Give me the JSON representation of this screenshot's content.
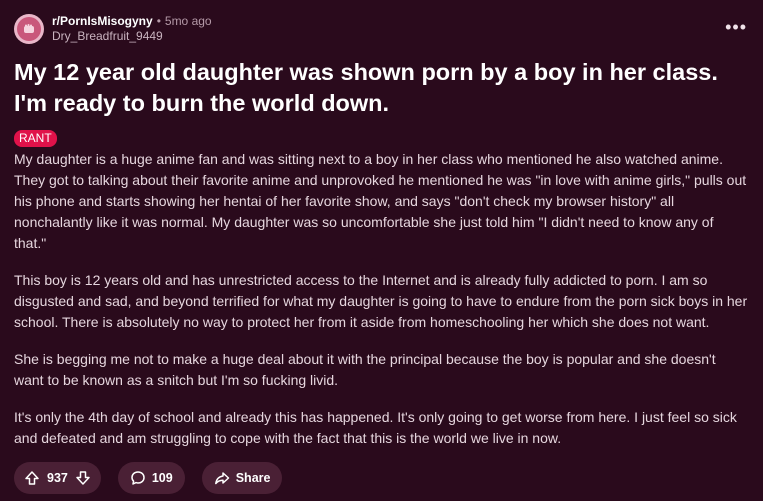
{
  "header": {
    "subreddit": "r/PornIsMisogyny",
    "separator": "•",
    "time": "5mo ago",
    "username": "Dry_Breadfruit_9449",
    "more": "•••"
  },
  "post": {
    "title": "My 12 year old daughter was shown porn by a boy in her class. I'm ready to burn the world down.",
    "flair": "RANT",
    "paragraphs": [
      "My daughter is a huge anime fan and was sitting next to a boy in her class who mentioned he also watched anime. They got to talking about their favorite anime and unprovoked he mentioned he was \"in love with anime girls,\" pulls out his phone and starts showing her hentai of her favorite show, and says \"don't check my browser history\" all nonchalantly like it was normal. My daughter was so uncomfortable she just told him \"I didn't need to know any of that.\"",
      "This boy is 12 years old and has unrestricted access to the Internet and is already fully addicted to porn. I am so disgusted and sad, and beyond terrified for what my daughter is going to have to endure from the porn sick boys in her school. There is absolutely no way to protect her from it aside from homeschooling her which she does not want.",
      "She is begging me not to make a huge deal about it with the principal because the boy is popular and she doesn't want to be known as a snitch but I'm so fucking livid.",
      "It's only the 4th day of school and already this has happened. It's only going to get worse from here. I just feel so sick and defeated and am struggling to cope with the fact that this is the world we live in now."
    ]
  },
  "actions": {
    "votes": "937",
    "comments": "109",
    "share_label": "Share"
  },
  "icons": {
    "upvote": "upvote-arrow-icon",
    "downvote": "downvote-arrow-icon",
    "comment": "comment-bubble-icon",
    "share": "share-arrow-icon",
    "avatar": "fist-icon"
  },
  "colors": {
    "background": "#2a0a1c",
    "flair": "#e0124a",
    "pill": "#4a2035"
  }
}
